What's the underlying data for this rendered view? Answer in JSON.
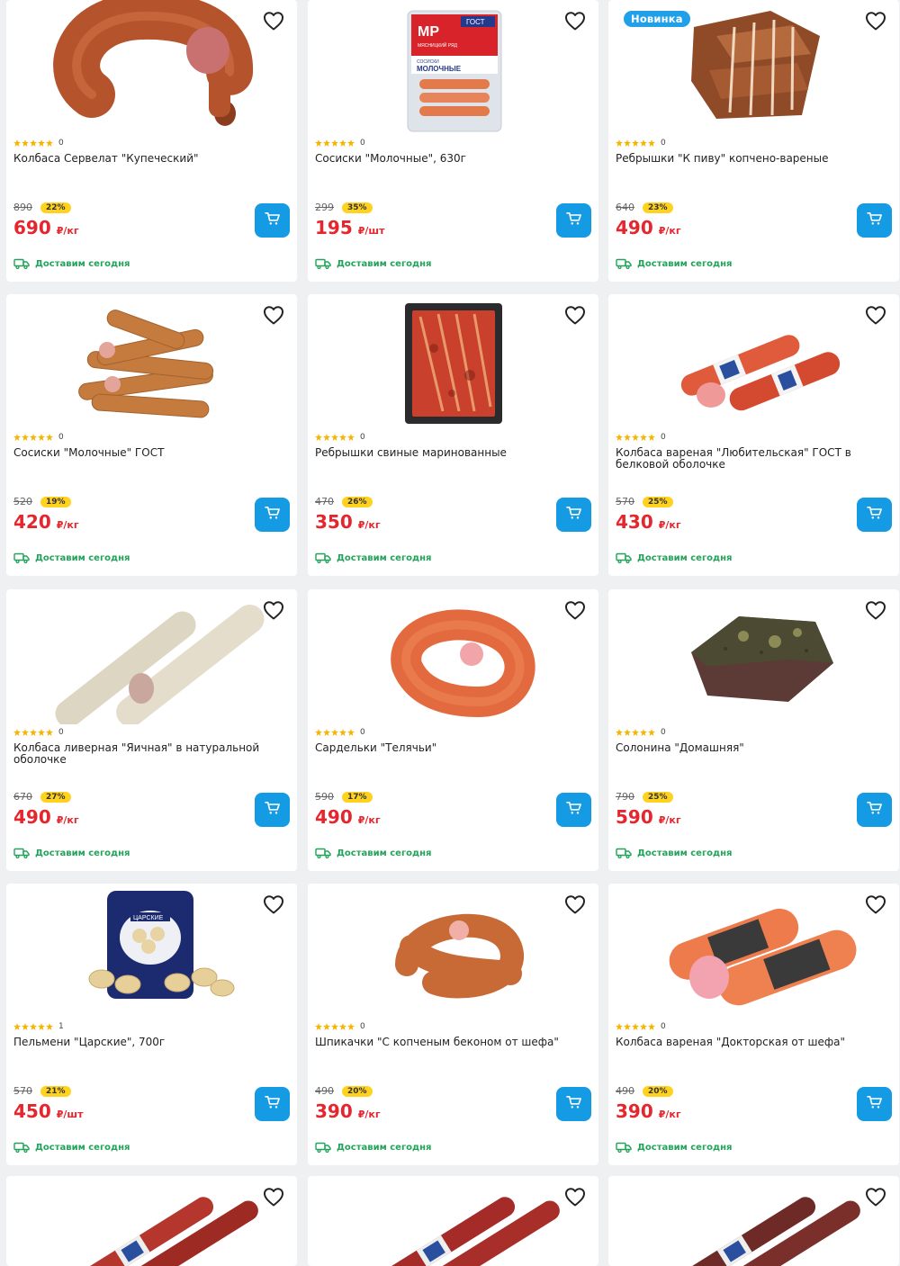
{
  "products": [
    {
      "name": "Колбаса Сервелат \"Купеческий\"",
      "rating": "0",
      "old_price": "890",
      "discount": "22%",
      "price": "690",
      "unit": "₽/кг",
      "delivery": "Доставим сегодня",
      "image": "cervelat-sausage-ring"
    },
    {
      "name": "Сосиски \"Молочные\", 630г",
      "rating": "0",
      "old_price": "299",
      "discount": "35%",
      "price": "195",
      "unit": "₽/шт",
      "delivery": "Доставим сегодня",
      "image": "milk-sausages-pack",
      "pack": {
        "logo": "МР",
        "brand": "МЯСНИЦКИЙ РЯД",
        "standard": "ГОСТ",
        "line1": "СОСИСКИ",
        "line2": "МОЛОЧНЫЕ"
      }
    },
    {
      "name": "Ребрышки \"К пиву\" копчено-вареные",
      "rating": "0",
      "old_price": "640",
      "discount": "23%",
      "price": "490",
      "unit": "₽/кг",
      "delivery": "Доставим сегодня",
      "image": "smoked-ribs",
      "badge": "Новинка"
    },
    {
      "name": "Сосиски \"Молочные\" ГОСТ",
      "rating": "0",
      "old_price": "520",
      "discount": "19%",
      "price": "420",
      "unit": "₽/кг",
      "delivery": "Доставим сегодня",
      "image": "sausages-pile"
    },
    {
      "name": "Ребрышки свиные маринованные",
      "rating": "0",
      "old_price": "470",
      "discount": "26%",
      "price": "350",
      "unit": "₽/кг",
      "delivery": "Доставим сегодня",
      "image": "marinated-ribs-tray"
    },
    {
      "name": "Колбаса вареная \"Любительская\" ГОСТ в белковой оболочке",
      "rating": "0",
      "old_price": "570",
      "discount": "25%",
      "price": "430",
      "unit": "₽/кг",
      "delivery": "Доставим сегодня",
      "image": "boiled-sausage-loaves"
    },
    {
      "name": "Колбаса ливерная \"Яичная\" в натуральной оболочке",
      "rating": "0",
      "old_price": "670",
      "discount": "27%",
      "price": "490",
      "unit": "₽/кг",
      "delivery": "Доставим сегодня",
      "image": "liver-sausage"
    },
    {
      "name": "Сардельки \"Телячьи\"",
      "rating": "0",
      "old_price": "590",
      "discount": "17%",
      "price": "490",
      "unit": "₽/кг",
      "delivery": "Доставим сегодня",
      "image": "veal-sardelki"
    },
    {
      "name": "Солонина \"Домашняя\"",
      "rating": "0",
      "old_price": "790",
      "discount": "25%",
      "price": "590",
      "unit": "₽/кг",
      "delivery": "Доставим сегодня",
      "image": "corned-beef"
    },
    {
      "name": "Пельмени \"Царские\", 700г",
      "rating": "1",
      "old_price": "570",
      "discount": "21%",
      "price": "450",
      "unit": "₽/шт",
      "delivery": "Доставим сегодня",
      "image": "dumplings-pack",
      "pack": {
        "label": "ЦАРСКИЕ"
      }
    },
    {
      "name": "Шпикачки \"С копченым беконом от шефа\"",
      "rating": "0",
      "old_price": "490",
      "discount": "20%",
      "price": "390",
      "unit": "₽/кг",
      "delivery": "Доставим сегодня",
      "image": "shpikachki"
    },
    {
      "name": "Колбаса вареная \"Докторская от шефа\"",
      "rating": "0",
      "old_price": "490",
      "discount": "20%",
      "price": "390",
      "unit": "₽/кг",
      "delivery": "Доставим сегодня",
      "image": "doctors-sausage"
    },
    {
      "image": "smoked-salami-a",
      "partial": true
    },
    {
      "image": "smoked-salami-b",
      "partial": true
    },
    {
      "image": "smoked-salami-c",
      "partial": true
    }
  ],
  "icons": {
    "favorite": "heart-outline-icon",
    "cart": "cart-icon",
    "delivery": "delivery-truck-icon",
    "rating": "star-icon"
  },
  "colors": {
    "price": "#e5262e",
    "discount_badge": "#ffd21f",
    "cart_button": "#159be4",
    "delivery_text": "#23a35a",
    "new_badge": "#1fa0e8",
    "star": "#f5b400"
  }
}
